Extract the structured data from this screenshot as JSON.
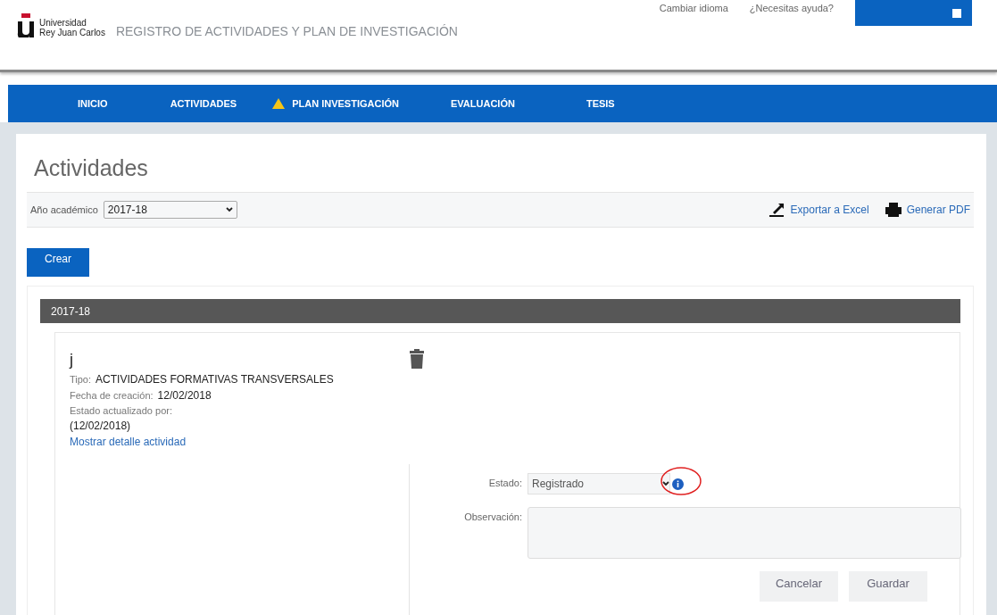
{
  "header": {
    "logo_lines": [
      "Universidad",
      "Rey Juan Carlos"
    ],
    "app_title": "REGISTRO DE ACTIVIDADES Y PLAN DE INVESTIGACIÓN",
    "language_link": "Cambiar idioma",
    "help_link": "¿Necesitas ayuda?"
  },
  "nav": [
    {
      "label": "INICIO",
      "warning": false
    },
    {
      "label": "ACTIVIDADES",
      "warning": false
    },
    {
      "label": "PLAN INVESTIGACIÓN",
      "warning": true
    },
    {
      "label": "EVALUACIÓN",
      "warning": false
    },
    {
      "label": "TESIS",
      "warning": false
    }
  ],
  "page": {
    "title": "Actividades",
    "year_label": "Año académico",
    "year_value": "2017-18",
    "export_excel": "Exportar a Excel",
    "generate_pdf": "Generar PDF",
    "create_button": "Crear"
  },
  "section": {
    "heading": "2017-18",
    "activity": {
      "name": "j",
      "fields": [
        {
          "label": "Tipo:",
          "value": "ACTIVIDADES FORMATIVAS TRANSVERSALES"
        },
        {
          "label": "Fecha de creación:",
          "value": "12/02/2018"
        }
      ],
      "updated_label": "Estado actualizado por:",
      "updated_value": "(12/02/2018)",
      "detail_link": "Mostrar detalle actividad",
      "state_label": "Estado:",
      "state_value": "Registrado",
      "info_highlighted": true,
      "observation_label": "Observación:",
      "buttons": [
        "Cancelar",
        "Guardar"
      ]
    }
  }
}
